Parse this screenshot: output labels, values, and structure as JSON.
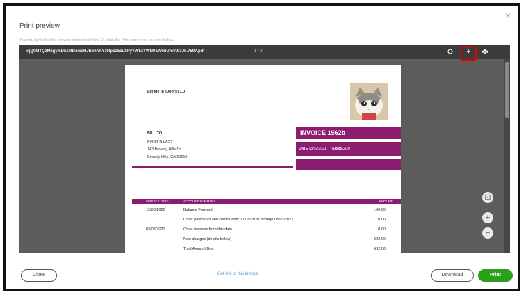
{
  "dialog": {
    "title": "Print preview",
    "hint": "To print, right-click the preview and select Print. Or, click the Print icon if you see one below.",
    "close_glyph": "×"
  },
  "viewer": {
    "filename": "djQ9MTQzMzgyMDkxMDowdHJhbnNhY3Rpb25zL1RyYW5zYWN0aW9uUmVjb3Jk.7597.pdf",
    "page_indicator": "1 / 2",
    "icons": {
      "rotate": "rotate-icon",
      "download": "download-icon",
      "print": "print-icon"
    },
    "side_controls": {
      "fit": "⊡",
      "zoom_in": "+",
      "zoom_out": "−"
    }
  },
  "invoice": {
    "from": "Let Me In (Doors) 1.0",
    "bill_to_heading": "BILL TO",
    "bill_to_lines": [
      "FIRST N LAST",
      "143 Beverly Hills Dr",
      "Beverly Hills, CA 90210"
    ],
    "title": "INVOICE 1962b",
    "date_label": "DATE",
    "date_value": "03/02/2021",
    "terms_label": "TERMS",
    "terms_value": "20%",
    "table_headers": {
      "date": "SERVICE DATE",
      "summary": "ACCOUNT SUMMARY",
      "amount": "AMOUNT"
    },
    "rows": [
      {
        "date": "12/08/2020",
        "desc": "Balance Forward",
        "amount": "160.00"
      },
      {
        "date": "",
        "desc": "Other payments and credits after 12/08/2020 through 03/02/2021",
        "amount": "0.00"
      },
      {
        "date": "03/03/2021",
        "desc": "Other invoices from this date",
        "amount": "0.00"
      },
      {
        "date": "",
        "desc": "New charges (details below)",
        "amount": "532.00"
      },
      {
        "date": "",
        "desc": "Total Amount Due",
        "amount": "692.00"
      }
    ]
  },
  "footer": {
    "close_label": "Close",
    "link_label": "Get link to this invoice",
    "download_label": "Download",
    "print_label": "Print"
  }
}
